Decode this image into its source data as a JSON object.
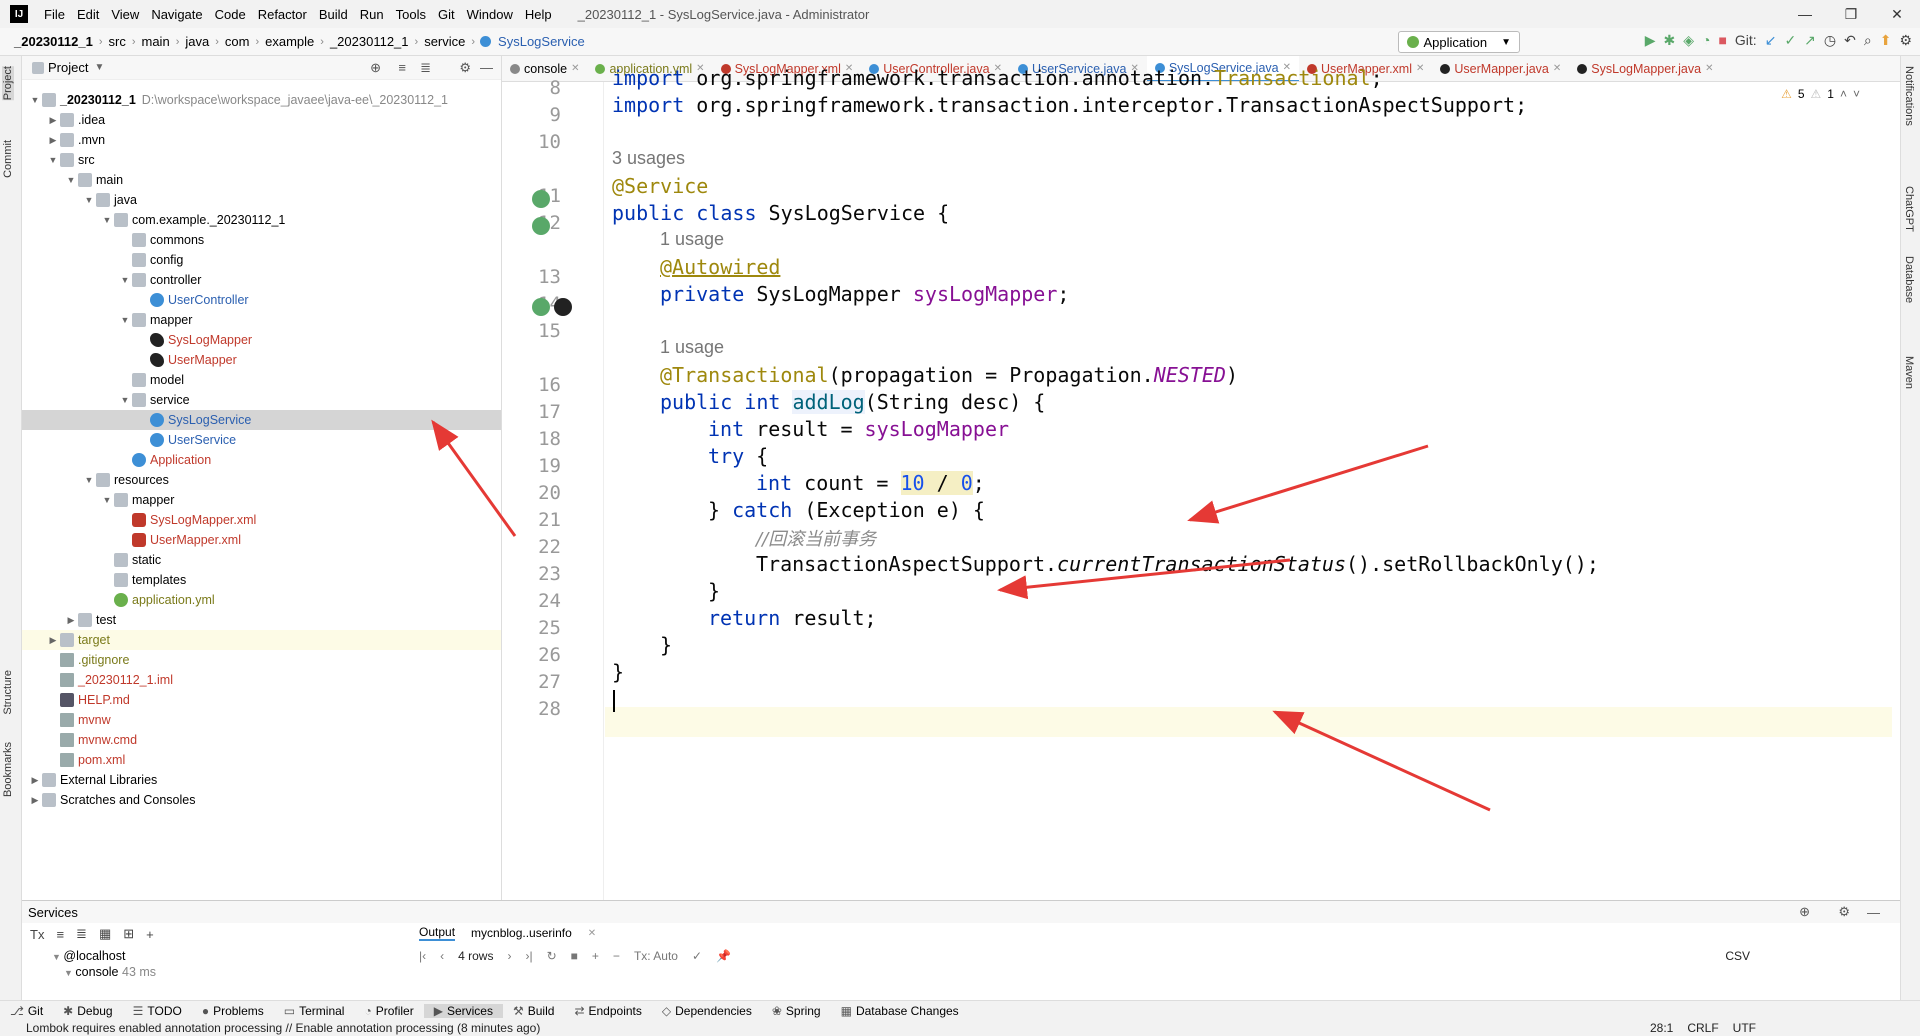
{
  "menubar": {
    "logo": "IJ",
    "items": [
      "File",
      "Edit",
      "View",
      "Navigate",
      "Code",
      "Refactor",
      "Build",
      "Run",
      "Tools",
      "Git",
      "Window",
      "Help"
    ],
    "title": "_20230112_1 - SysLogService.java - Administrator"
  },
  "breadcrumbs": [
    "_20230112_1",
    "src",
    "main",
    "java",
    "com",
    "example",
    "_20230112_1",
    "service",
    "SysLogService"
  ],
  "toolbar": {
    "run_config": "Application",
    "git_label": "Git:"
  },
  "left_strip": {
    "project": "Project",
    "commit": "Commit",
    "structure": "Structure",
    "bookmarks": "Bookmarks"
  },
  "right_strip": {
    "notifications": "Notifications",
    "chatgpt": "ChatGPT",
    "database": "Database",
    "maven": "Maven"
  },
  "project_panel": {
    "title": "Project",
    "tree": [
      {
        "label": "_20230112_1",
        "extra": "D:\\workspace\\workspace_javaee\\java-ee\\_20230112_1",
        "icon": "folder",
        "depth": 0,
        "open": true,
        "bold": true
      },
      {
        "label": ".idea",
        "icon": "folder",
        "depth": 1,
        "open": false
      },
      {
        "label": ".mvn",
        "icon": "folder",
        "depth": 1,
        "open": false
      },
      {
        "label": "src",
        "icon": "folder",
        "depth": 1,
        "open": true
      },
      {
        "label": "main",
        "icon": "folder",
        "depth": 2,
        "open": true
      },
      {
        "label": "java",
        "icon": "folder",
        "depth": 3,
        "open": true
      },
      {
        "label": "com.example._20230112_1",
        "icon": "folder",
        "depth": 4,
        "open": true
      },
      {
        "label": "commons",
        "icon": "folder",
        "depth": 5
      },
      {
        "label": "config",
        "icon": "folder",
        "depth": 5
      },
      {
        "label": "controller",
        "icon": "folder",
        "depth": 5,
        "open": true
      },
      {
        "label": "UserController",
        "icon": "cls",
        "depth": 6,
        "color": "blue"
      },
      {
        "label": "mapper",
        "icon": "folder",
        "depth": 5,
        "open": true
      },
      {
        "label": "SysLogMapper",
        "icon": "bird",
        "depth": 6,
        "color": "red"
      },
      {
        "label": "UserMapper",
        "icon": "bird",
        "depth": 6,
        "color": "red"
      },
      {
        "label": "model",
        "icon": "folder",
        "depth": 5
      },
      {
        "label": "service",
        "icon": "folder",
        "depth": 5,
        "open": true
      },
      {
        "label": "SysLogService",
        "icon": "cls",
        "depth": 6,
        "color": "blue",
        "selected": true
      },
      {
        "label": "UserService",
        "icon": "cls",
        "depth": 6,
        "color": "blue"
      },
      {
        "label": "Application",
        "icon": "cls",
        "depth": 5,
        "color": "red"
      },
      {
        "label": "resources",
        "icon": "folder",
        "depth": 3,
        "open": true
      },
      {
        "label": "mapper",
        "icon": "folder",
        "depth": 4,
        "open": true
      },
      {
        "label": "SysLogMapper.xml",
        "icon": "xml",
        "depth": 5,
        "color": "red"
      },
      {
        "label": "UserMapper.xml",
        "icon": "xml",
        "depth": 5,
        "color": "red"
      },
      {
        "label": "static",
        "icon": "folder",
        "depth": 4
      },
      {
        "label": "templates",
        "icon": "folder",
        "depth": 4
      },
      {
        "label": "application.yml",
        "icon": "spring",
        "depth": 4,
        "color": "olive"
      },
      {
        "label": "test",
        "icon": "folder",
        "depth": 2,
        "open": false
      },
      {
        "label": "target",
        "icon": "folder",
        "depth": 1,
        "open": false,
        "color": "olive",
        "highlight": true
      },
      {
        "label": ".gitignore",
        "icon": "file",
        "depth": 1,
        "color": "olive"
      },
      {
        "label": "_20230112_1.iml",
        "icon": "file",
        "depth": 1,
        "color": "red"
      },
      {
        "label": "HELP.md",
        "icon": "mdi",
        "depth": 1,
        "color": "red"
      },
      {
        "label": "mvnw",
        "icon": "file",
        "depth": 1,
        "color": "red"
      },
      {
        "label": "mvnw.cmd",
        "icon": "file",
        "depth": 1,
        "color": "red"
      },
      {
        "label": "pom.xml",
        "icon": "file",
        "depth": 1,
        "color": "red"
      },
      {
        "label": "External Libraries",
        "icon": "folder",
        "depth": 0,
        "open": false
      },
      {
        "label": "Scratches and Consoles",
        "icon": "folder",
        "depth": 0,
        "open": false
      }
    ]
  },
  "editor": {
    "tabs": [
      {
        "label": "console",
        "color": "#888"
      },
      {
        "label": "application.yml",
        "color": "#6ab04c",
        "text": "olive"
      },
      {
        "label": "SysLogMapper.xml",
        "color": "#c0392b",
        "text": "red"
      },
      {
        "label": "UserController.java",
        "color": "#3d8fd6",
        "text": "red"
      },
      {
        "label": "UserService.java",
        "color": "#3d8fd6",
        "text": "blue"
      },
      {
        "label": "SysLogService.java",
        "color": "#3d8fd6",
        "text": "blue",
        "active": true
      },
      {
        "label": "UserMapper.xml",
        "color": "#c0392b",
        "text": "red"
      },
      {
        "label": "UserMapper.java",
        "color": "#222",
        "text": "red"
      },
      {
        "label": "SysLogMapper.java",
        "color": "#222",
        "text": "red"
      }
    ],
    "inspection": {
      "warnings": "5",
      "weak": "1"
    },
    "line_numbers": [
      "8",
      "9",
      "10",
      "11",
      "12",
      "13",
      "14",
      "15",
      "16",
      "17",
      "18",
      "19",
      "20",
      "21",
      "22",
      "23",
      "24",
      "25",
      "26",
      "27",
      "28"
    ],
    "usages": {
      "class": "3 usages",
      "field": "1 usage",
      "method": "1 usage"
    },
    "code": {
      "l8a": "import ",
      "l8b": "org.springframework.transaction.annotation.",
      "l8c": "Transactional",
      "l8d": ";",
      "l9a": "import ",
      "l9b": "org.springframework.transaction.interceptor.TransactionAspectSupport;",
      "l11": "@Service",
      "l12a": "public class ",
      "l12b": "SysLogService {",
      "l13": "@Autowired",
      "l14a": "private ",
      "l14b": "SysLogMapper ",
      "l14c": "sysLogMapper",
      ";": ";",
      "l16a": "@Transactional",
      "l16b": "(propagation = Propagation.",
      "l16c": "NESTED",
      "l16d": ")",
      "l17a": "public int ",
      "l17b": "addLog",
      "l17c": "(String desc) {",
      "l18a": "int ",
      "l18b": "result = ",
      "l18c": "sysLogMapper",
      ".addLog": ".addLog(desc);",
      "l19a": "try ",
      "l19b": "{",
      "l20a": "int ",
      "l20b": "count = ",
      "l20c": "10",
      " / ": " / ",
      "l20d": "0",
      "l20e": ";",
      "l21a": "} ",
      "l21b": "catch ",
      "l21c": "(Exception e) {",
      "l22": "//回滚当前事务",
      "l23a": "TransactionAspectSupport.",
      "l23b": "currentTransactionStatus",
      "l23c": "().setRollbackOnly();",
      "l24": "}",
      "l25a": "return ",
      "l25b": "result;",
      "l26": "}",
      "l27": "}"
    }
  },
  "services": {
    "title": "Services",
    "tree": [
      {
        "label": "@localhost"
      },
      {
        "label": "console",
        "meta": "43 ms"
      }
    ],
    "tabs": [
      "Output",
      "mycnblog..userinfo"
    ],
    "rows_label": "4 rows",
    "tx_label": "Tx: Auto",
    "csv_label": "CSV"
  },
  "tool_windows": [
    "Git",
    "Debug",
    "TODO",
    "Problems",
    "Terminal",
    "Profiler",
    "Services",
    "Build",
    "Endpoints",
    "Dependencies",
    "Spring",
    "Database Changes"
  ],
  "status": {
    "message": "Lombok requires enabled annotation processing // Enable annotation processing (8 minutes ago)",
    "position": "28:1",
    "line_sep": "CRLF",
    "encoding": "UTF"
  }
}
